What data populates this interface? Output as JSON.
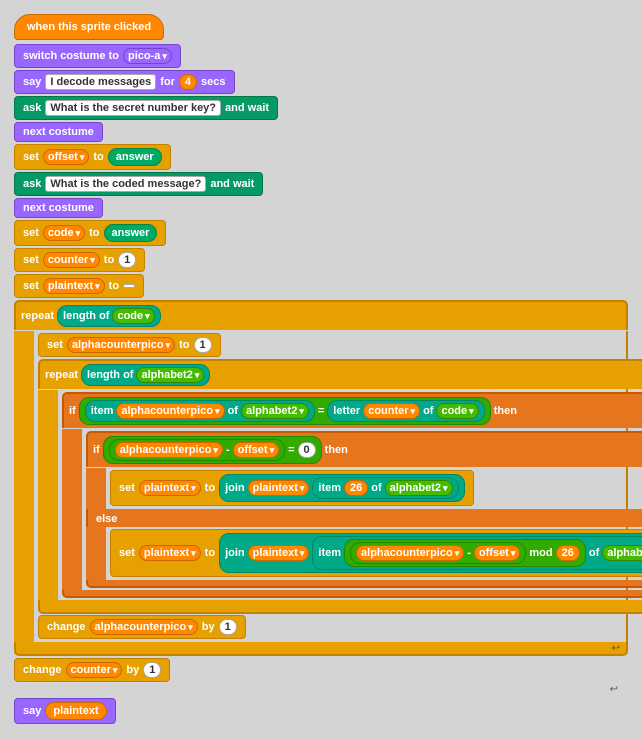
{
  "blocks": {
    "hat": "when this sprite clicked",
    "switch_costume": "switch costume to",
    "costume_val": "pico-a",
    "say": "say",
    "say_val": "I decode messages",
    "say_for": "for",
    "say_secs": "4",
    "say_unit": "secs",
    "ask1": "ask",
    "ask1_val": "What is the secret number key?",
    "ask1_wait": "and wait",
    "next_costume": "next costume",
    "set": "set",
    "offset_var": "offset",
    "to": "to",
    "answer": "answer",
    "ask2_val": "What is the coded message?",
    "code_var": "code",
    "counter_var": "counter",
    "counter_val": "1",
    "plaintext_var": "plaintext",
    "repeat": "repeat",
    "length_of": "length of",
    "code_ref": "code",
    "set_alpha": "alphacounterpico",
    "alpha_val": "1",
    "repeat2": "repeat",
    "length_of2": "length of",
    "alphabet2": "alphabet2",
    "if_label": "if",
    "item_label": "item",
    "of_label": "of",
    "equals": "=",
    "letter_label": "letter",
    "then_label": "then",
    "if2_label": "if",
    "minus": "-",
    "zero": "0",
    "then2_label": "then",
    "join_label": "join",
    "item26_label": "item",
    "num26": "26",
    "else_label": "else",
    "mod_label": "mod",
    "mod26": "26",
    "change_label": "change",
    "by_label": "by",
    "change_counter": "change",
    "counter_by": "counter",
    "say_plaintext": "say",
    "plaintext_ref": "plaintext"
  }
}
